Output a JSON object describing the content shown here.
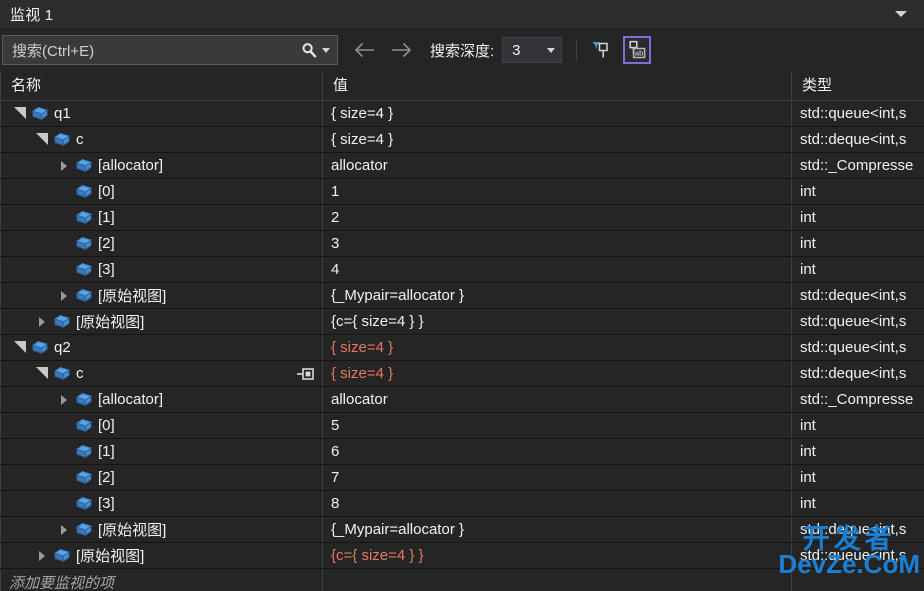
{
  "window": {
    "title": "监视 1",
    "collapse_icon": "chevron-down-icon"
  },
  "toolbar": {
    "search_placeholder": "搜索(Ctrl+E)",
    "search_icon": "search-icon",
    "search_dropdown_icon": "chevron-down-icon",
    "back_icon": "arrow-left-icon",
    "forward_icon": "arrow-right-icon",
    "depth_label": "搜索深度:",
    "depth_value": "3",
    "depth_dropdown_icon": "chevron-down-icon",
    "pin_filter_icon": "pin-filter-icon",
    "pin_ab_icon": "pin-ab-icon",
    "accent_selected": "#7e6fdd"
  },
  "grid": {
    "columns": [
      {
        "key": "name",
        "label": "名称"
      },
      {
        "key": "value",
        "label": "值"
      },
      {
        "key": "type",
        "label": "类型"
      }
    ],
    "changed_color": "#e8795c",
    "rows": [
      {
        "indent": 0,
        "twisty": "expanded",
        "name": "q1",
        "value": "{ size=4 }",
        "type": "std::queue<int,s",
        "changed": false,
        "pin": false
      },
      {
        "indent": 1,
        "twisty": "expanded",
        "name": "c",
        "value": "{ size=4 }",
        "type": "std::deque<int,s",
        "changed": false,
        "pin": false
      },
      {
        "indent": 2,
        "twisty": "collapsed",
        "name": "[allocator]",
        "value": "allocator",
        "type": "std::_Compresse",
        "changed": false,
        "pin": false
      },
      {
        "indent": 2,
        "twisty": "none",
        "name": "[0]",
        "value": "1",
        "type": "int",
        "changed": false,
        "pin": false
      },
      {
        "indent": 2,
        "twisty": "none",
        "name": "[1]",
        "value": "2",
        "type": "int",
        "changed": false,
        "pin": false
      },
      {
        "indent": 2,
        "twisty": "none",
        "name": "[2]",
        "value": "3",
        "type": "int",
        "changed": false,
        "pin": false
      },
      {
        "indent": 2,
        "twisty": "none",
        "name": "[3]",
        "value": "4",
        "type": "int",
        "changed": false,
        "pin": false
      },
      {
        "indent": 2,
        "twisty": "collapsed",
        "name": "[原始视图]",
        "value": "{_Mypair=allocator }",
        "type": "std::deque<int,s",
        "changed": false,
        "pin": false
      },
      {
        "indent": 1,
        "twisty": "collapsed",
        "name": "[原始视图]",
        "value": "{c={ size=4 } }",
        "type": "std::queue<int,s",
        "changed": false,
        "pin": false
      },
      {
        "indent": 0,
        "twisty": "expanded",
        "name": "q2",
        "value": "{ size=4 }",
        "type": "std::queue<int,s",
        "changed": true,
        "pin": false
      },
      {
        "indent": 1,
        "twisty": "expanded",
        "name": "c",
        "value": "{ size=4 }",
        "type": "std::deque<int,s",
        "changed": true,
        "pin": true
      },
      {
        "indent": 2,
        "twisty": "collapsed",
        "name": "[allocator]",
        "value": "allocator",
        "type": "std::_Compresse",
        "changed": false,
        "pin": false
      },
      {
        "indent": 2,
        "twisty": "none",
        "name": "[0]",
        "value": "5",
        "type": "int",
        "changed": false,
        "pin": false
      },
      {
        "indent": 2,
        "twisty": "none",
        "name": "[1]",
        "value": "6",
        "type": "int",
        "changed": false,
        "pin": false
      },
      {
        "indent": 2,
        "twisty": "none",
        "name": "[2]",
        "value": "7",
        "type": "int",
        "changed": false,
        "pin": false
      },
      {
        "indent": 2,
        "twisty": "none",
        "name": "[3]",
        "value": "8",
        "type": "int",
        "changed": false,
        "pin": false
      },
      {
        "indent": 2,
        "twisty": "collapsed",
        "name": "[原始视图]",
        "value": "{_Mypair=allocator }",
        "type": "std::deque<int,s",
        "changed": false,
        "pin": false
      },
      {
        "indent": 1,
        "twisty": "collapsed",
        "name": "[原始视图]",
        "value": "{c={ size=4 } }",
        "type": "std::queue<int,s",
        "changed": true,
        "pin": false
      }
    ],
    "add_row_placeholder": "添加要监视的项"
  },
  "watermark": {
    "line1": "开发者",
    "line2": "DevZe.CoM",
    "color": "#1b7fd4"
  }
}
